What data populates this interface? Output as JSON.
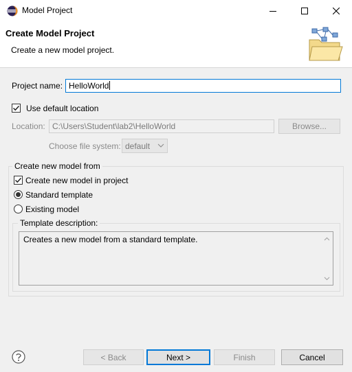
{
  "window": {
    "title": "Model Project",
    "icon": "eclipse-icon"
  },
  "banner": {
    "title": "Create Model Project",
    "subtitle": "Create a new model project.",
    "image": "folder-diagram-icon"
  },
  "form": {
    "project_name_label": "Project name:",
    "project_name_value": "HelloWorld",
    "use_default_location_label": "Use default location",
    "use_default_location_checked": true,
    "location_label": "Location:",
    "location_value": "C:\\Users\\Student\\lab2\\HelloWorld",
    "browse_label": "Browse...",
    "file_system_label": "Choose file system:",
    "file_system_value": "default"
  },
  "model_group": {
    "title": "Create new model from",
    "create_in_project_label": "Create new model in project",
    "create_in_project_checked": true,
    "options": [
      {
        "label": "Standard template",
        "selected": true
      },
      {
        "label": "Existing model",
        "selected": false
      }
    ],
    "template_description_title": "Template description:",
    "template_description_text": "Creates a new model from a standard template."
  },
  "footer": {
    "help_icon": "help-icon",
    "back_label": "< Back",
    "next_label": "Next >",
    "finish_label": "Finish",
    "cancel_label": "Cancel"
  },
  "colors": {
    "focus_accent": "#0078d7",
    "dialog_background": "#f0f0f0",
    "banner_background": "#ffffff"
  }
}
